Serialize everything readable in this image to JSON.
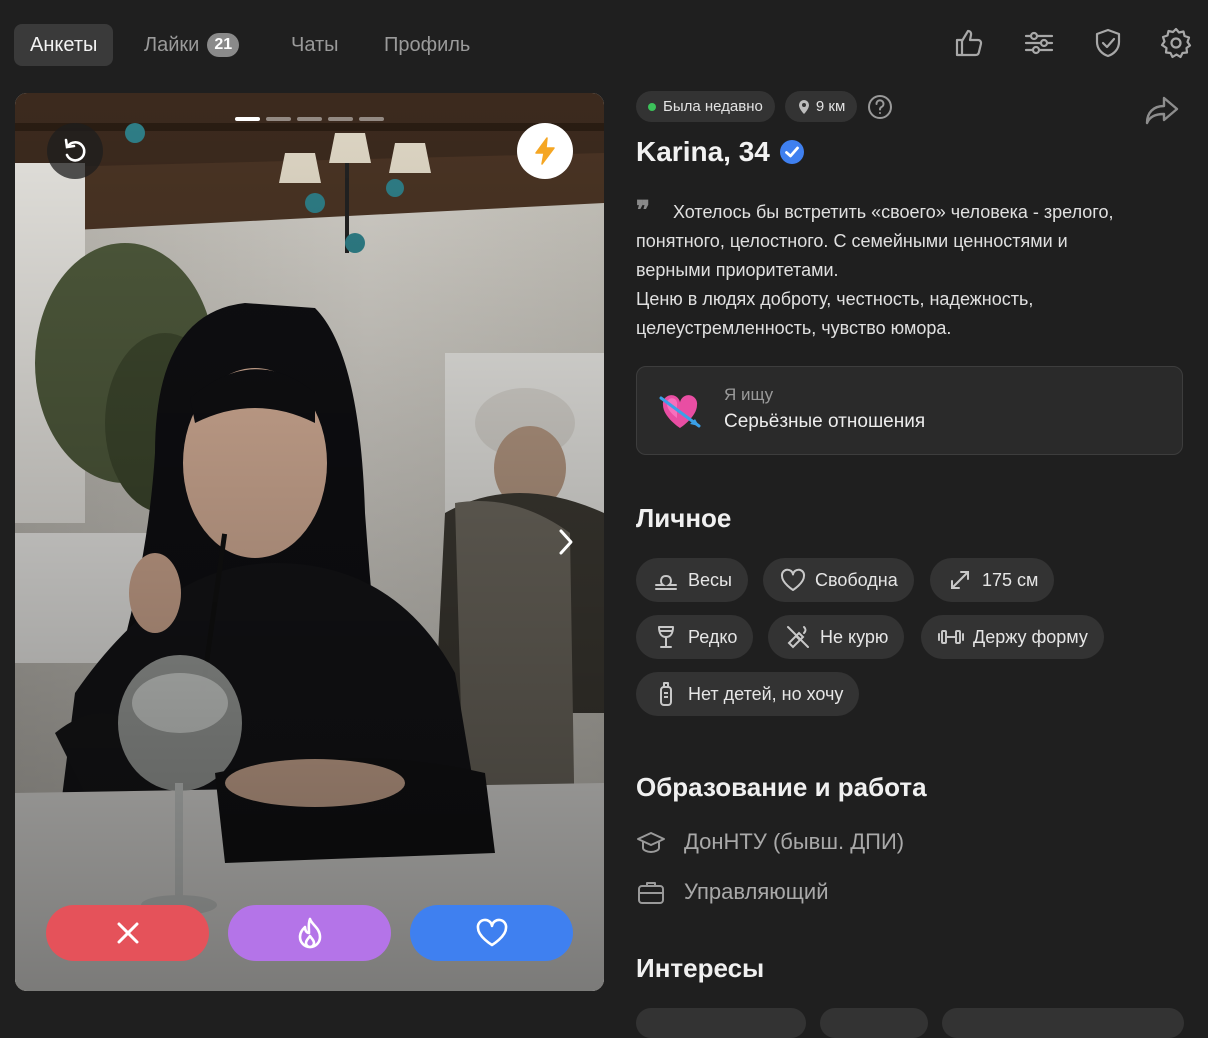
{
  "nav": {
    "tabs": [
      {
        "label": "Анкеты",
        "active": true
      },
      {
        "label": "Лайки",
        "badge": "21"
      },
      {
        "label": "Чаты"
      },
      {
        "label": "Профиль"
      }
    ],
    "icons": [
      "thumbs-up-icon",
      "filter-sliders-icon",
      "shield-check-icon",
      "gear-icon"
    ]
  },
  "card": {
    "photo_count": 5,
    "current_photo": 1,
    "buttons": [
      "rewind-icon",
      "boost-lightning-icon",
      "dislike-x-icon",
      "superlike-fire-icon",
      "like-heart-icon"
    ],
    "colors": {
      "dislike": "#e5525a",
      "superlike": "#b474e8",
      "like": "#3f80f0",
      "boost": "#f5a623"
    }
  },
  "profile": {
    "status": "Была недавно",
    "status_color": "#3cc15a",
    "distance": "9 км",
    "name": "Karina, 34",
    "verified": true,
    "about": "Хотелось бы встретить «своего» человека - зрелого,\nпонятного, целостного. С семейными ценностями и\nверными приоритетами.\nЦеню в людях доброту, честность, надежность,\nцелеустремленность, чувство юмора.",
    "seeking_label": "Я ищу",
    "seeking_value": "Серьёзные отношения"
  },
  "personal": {
    "title": "Личное",
    "chips": [
      {
        "icon": "libra-icon",
        "label": "Весы"
      },
      {
        "icon": "heart-outline-icon",
        "label": "Свободна"
      },
      {
        "icon": "height-arrows-icon",
        "label": "175 см"
      },
      {
        "icon": "wine-glass-icon",
        "label": "Редко"
      },
      {
        "icon": "no-smoking-icon",
        "label": "Не курю"
      },
      {
        "icon": "dumbbell-icon",
        "label": "Держу форму"
      },
      {
        "icon": "baby-bottle-icon",
        "label": "Нет детей, но хочу"
      }
    ]
  },
  "education": {
    "title": "Образование и работа",
    "school": "ДонНТУ (бывш. ДПИ)",
    "job": "Управляющий"
  },
  "interests": {
    "title": "Интересы"
  }
}
